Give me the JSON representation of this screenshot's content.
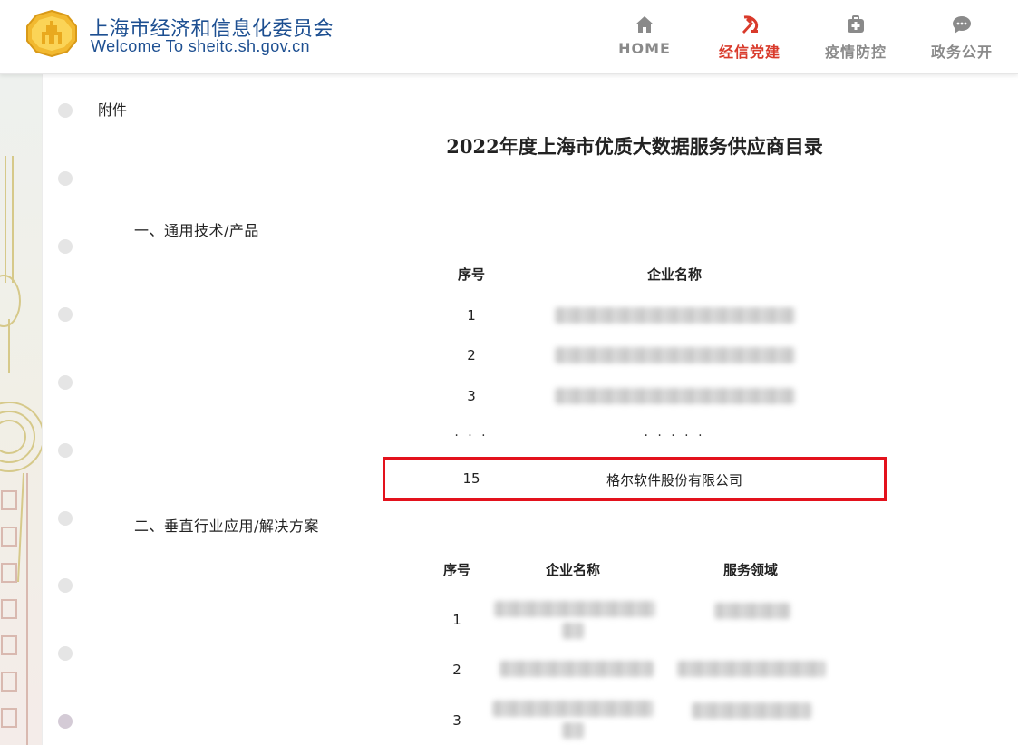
{
  "header": {
    "site_name_cn": "上海市经济和信息化委员会",
    "site_name_en": "Welcome To sheitc.sh.gov.cn",
    "nav": [
      {
        "label": "HOME",
        "icon": "home-icon",
        "active": false
      },
      {
        "label": "经信党建",
        "icon": "party-emblem-icon",
        "active": true
      },
      {
        "label": "疫情防控",
        "icon": "medical-kit-icon",
        "active": false
      },
      {
        "label": "政务公开",
        "icon": "chat-bubble-icon",
        "active": false
      }
    ]
  },
  "colors": {
    "brand_blue": "#1d4f91",
    "active_red": "#d93a2b",
    "highlight_red": "#e3121d",
    "nav_gray": "#8a8a8a"
  },
  "document": {
    "attachment_label": "附件",
    "title": "2022年度上海市优质大数据服务供应商目录",
    "section1": {
      "heading": "一、通用技术/产品",
      "headers": {
        "index": "序号",
        "company": "企业名称"
      },
      "rows": [
        "1",
        "2",
        "3"
      ],
      "ellipsis_index": "· · ·",
      "ellipsis_company": "· · · · ·",
      "highlight_row": {
        "index": "15",
        "company": "格尔软件股份有限公司"
      }
    },
    "section2": {
      "heading": "二、垂直行业应用/解决方案",
      "headers": {
        "index": "序号",
        "company": "企业名称",
        "field": "服务领域"
      },
      "rows": [
        "1",
        "2",
        "3"
      ]
    }
  }
}
